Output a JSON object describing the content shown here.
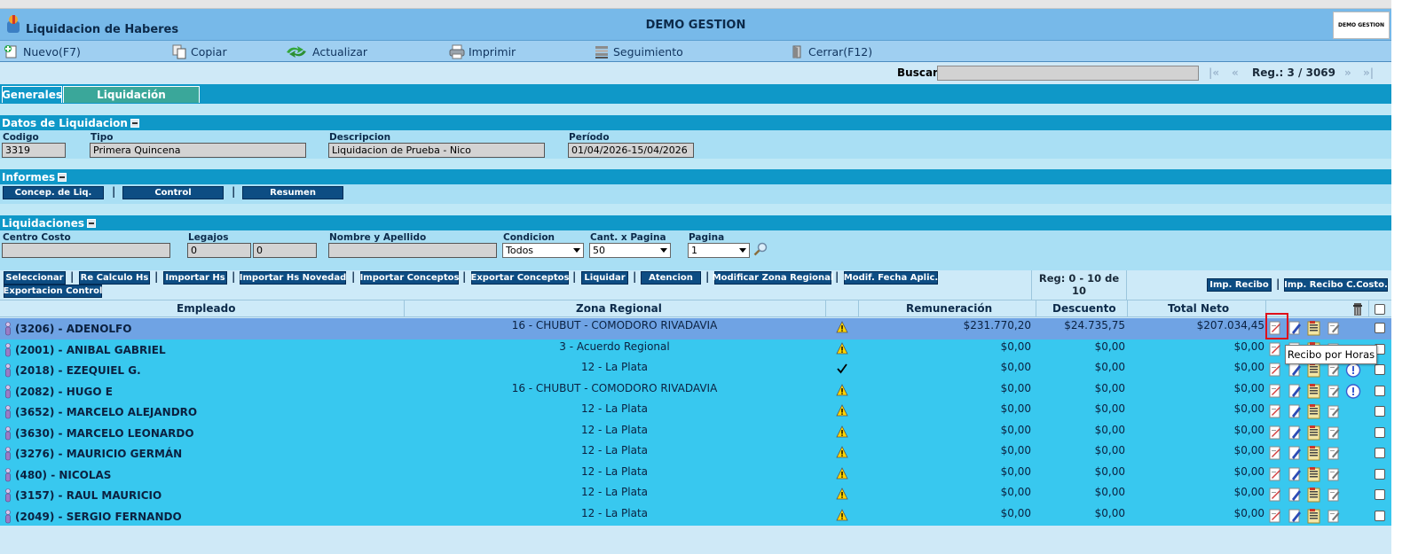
{
  "app": {
    "title": "Liquidacion de Haberes",
    "company": "DEMO GESTION",
    "brand": "DEMO GESTION"
  },
  "toolbar": {
    "nuevo": "Nuevo(F7)",
    "copiar": "Copiar",
    "actualizar": "Actualizar",
    "imprimir": "Imprimir",
    "seguimiento": "Seguimiento",
    "cerrar": "Cerrar(F12)"
  },
  "search": {
    "label": "Buscar",
    "value": "",
    "first": "|«",
    "prev": "«",
    "next": "»",
    "last": "»|",
    "counter": "Reg.: 3 / 3069"
  },
  "tabs": {
    "generales": "Generales",
    "liquidacion": "Liquidación"
  },
  "datos": {
    "header": "Datos de Liquidacion",
    "codigo_label": "Codigo",
    "codigo": "3319",
    "tipo_label": "Tipo",
    "tipo": "Primera Quincena",
    "descripcion_label": "Descripcion",
    "descripcion": "Liquidacion de Prueba - Nico",
    "periodo_label": "Período",
    "periodo": "01/04/2026-15/04/2026"
  },
  "informes": {
    "header": "Informes",
    "buttons": [
      "Concep. de Liq.",
      "Control",
      "Resumen"
    ]
  },
  "liquidaciones": {
    "header": "Liquidaciones",
    "centro_costo_label": "Centro Costo",
    "centro_costo": "",
    "legajos_label": "Legajos",
    "legajo_desde": "0",
    "legajo_hasta": "0",
    "nombre_label": "Nombre y Apellido",
    "nombre": "",
    "condicion_label": "Condicion",
    "condicion": "Todos",
    "cant_label": "Cant. x Pagina",
    "cant": "50",
    "pagina_label": "Pagina",
    "pagina": "1"
  },
  "actions": {
    "seleccionar": "Seleccionar",
    "recalculo": "Re Calculo Hs",
    "importar_hs": "Importar Hs",
    "importar_novedad": "Importar Hs Novedad",
    "importar_conceptos": "Importar Conceptos",
    "exportar_conceptos": "Exportar Conceptos",
    "liquidar": "Liquidar",
    "atencion": "Atencion",
    "modificar_zona": "Modificar Zona Regional",
    "modif_fecha": "Modif. Fecha Aplic.",
    "exportacion_control": "Exportacion Control",
    "reg": "Reg: 0 - 10 de 10",
    "imp_recibo": "Imp. Recibo",
    "imp_recibo_ccosto": "Imp. Recibo C.Costo."
  },
  "table": {
    "headers": {
      "empleado": "Empleado",
      "zona": "Zona Regional",
      "remuneracion": "Remuneración",
      "descuento": "Descuento",
      "total_neto": "Total Neto"
    },
    "rows": [
      {
        "empleado": "(3206) - ADENOLFO",
        "zona": "16 - CHUBUT - COMODORO RIVADAVIA",
        "status": "warning",
        "remuneracion": "$231.770,20",
        "descuento": "$24.735,75",
        "total_neto": "$207.034,45",
        "selected": true,
        "alert": false
      },
      {
        "empleado": "(2001) - ANIBAL GABRIEL",
        "zona": "3 - Acuerdo Regional",
        "status": "warning",
        "remuneracion": "$0,00",
        "descuento": "$0,00",
        "total_neto": "$0,00",
        "selected": false,
        "alert": false
      },
      {
        "empleado": "(2018) - EZEQUIEL G.",
        "zona": "12 - La Plata",
        "status": "check",
        "remuneracion": "$0,00",
        "descuento": "$0,00",
        "total_neto": "$0,00",
        "selected": false,
        "alert": true
      },
      {
        "empleado": "(2082) - HUGO E",
        "zona": "16 - CHUBUT - COMODORO RIVADAVIA",
        "status": "warning",
        "remuneracion": "$0,00",
        "descuento": "$0,00",
        "total_neto": "$0,00",
        "selected": false,
        "alert": true
      },
      {
        "empleado": "(3652) - MARCELO ALEJANDRO",
        "zona": "12 - La Plata",
        "status": "warning",
        "remuneracion": "$0,00",
        "descuento": "$0,00",
        "total_neto": "$0,00",
        "selected": false,
        "alert": false
      },
      {
        "empleado": "(3630) - MARCELO LEONARDO",
        "zona": "12 - La Plata",
        "status": "warning",
        "remuneracion": "$0,00",
        "descuento": "$0,00",
        "total_neto": "$0,00",
        "selected": false,
        "alert": false
      },
      {
        "empleado": "(3276) - MAURICIO GERMÁN",
        "zona": "12 - La Plata",
        "status": "warning",
        "remuneracion": "$0,00",
        "descuento": "$0,00",
        "total_neto": "$0,00",
        "selected": false,
        "alert": false
      },
      {
        "empleado": "(480) - NICOLAS",
        "zona": "12 - La Plata",
        "status": "warning",
        "remuneracion": "$0,00",
        "descuento": "$0,00",
        "total_neto": "$0,00",
        "selected": false,
        "alert": false
      },
      {
        "empleado": "(3157) - RAUL MAURICIO",
        "zona": "12 - La Plata",
        "status": "warning",
        "remuneracion": "$0,00",
        "descuento": "$0,00",
        "total_neto": "$0,00",
        "selected": false,
        "alert": false
      },
      {
        "empleado": "(2049) - SERGIO FERNANDO",
        "zona": "12 - La Plata",
        "status": "warning",
        "remuneracion": "$0,00",
        "descuento": "$0,00",
        "total_neto": "$0,00",
        "selected": false,
        "alert": false
      }
    ]
  },
  "tooltip": "Recibo por Horas"
}
